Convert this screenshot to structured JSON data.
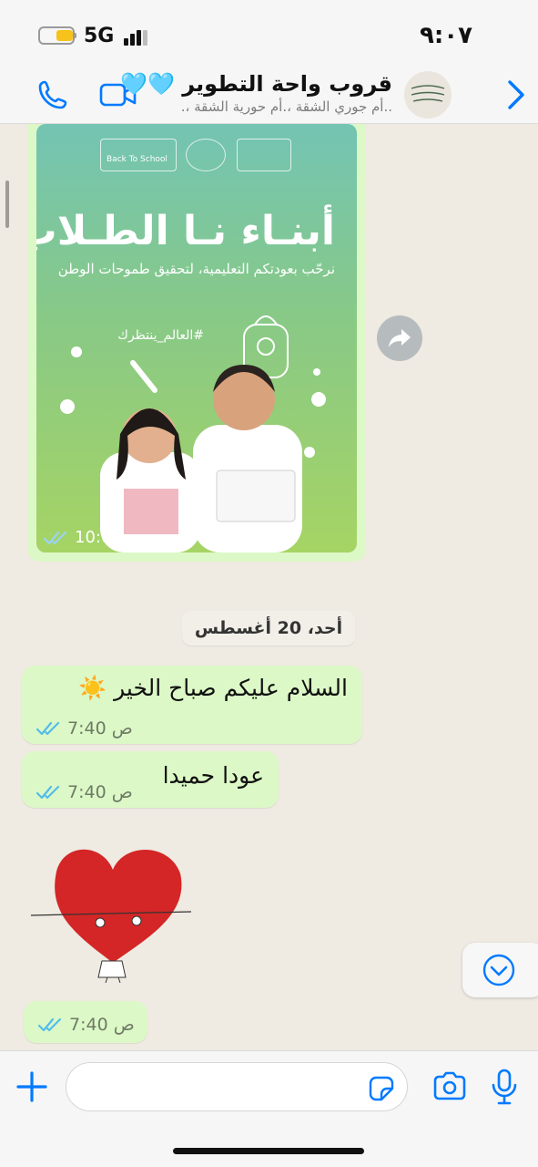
{
  "status_bar": {
    "network": "5G",
    "time": "٩:٠٧"
  },
  "header": {
    "title": "قروب واحة التطوير 🩵🩵",
    "subtitle": "..أم جوري الشقة ،.أم حورية الشقة ،."
  },
  "messages": {
    "image_post": {
      "headline": "أبنـاء نـا الطـلاب ..",
      "subline": "نرحّب بعودتكم التعليمية، لتحقيق طموحات الوطن",
      "hashtag": "#العالم_ينتظرك",
      "logo_text": "Back To School",
      "time": "10:02 م"
    },
    "date_separator": "أحد، 20 أغسطس",
    "greeting": {
      "text": "السلام عليكم صباح الخير ☀️",
      "time": "7:40 ص"
    },
    "wish": {
      "text": "عودا حميدا",
      "time": "7:40 ص"
    },
    "sticker": {
      "time": "7:40 ص"
    }
  },
  "colors": {
    "outgoing_bubble": "#dcf8c6",
    "accent": "#007aff",
    "read_ticks": "#53bdeb"
  },
  "icons": {
    "back": "chevron-right-icon",
    "video": "video-camera-icon",
    "call": "phone-icon",
    "forward": "forward-icon",
    "scroll_down": "chevron-down-icon",
    "attach": "plus-icon",
    "sticker": "sticker-icon",
    "camera": "camera-icon",
    "mic": "microphone-icon"
  }
}
